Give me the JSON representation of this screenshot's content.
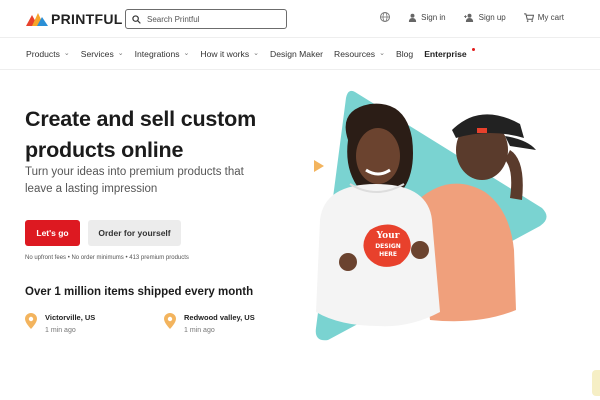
{
  "header": {
    "brand": "PRINTFUL",
    "search": {
      "placeholder": "Search Printful",
      "value": ""
    },
    "actions": [
      {
        "label": "Sign in",
        "icon": "user-icon"
      },
      {
        "label": "Sign up",
        "icon": "user-plus-icon"
      },
      {
        "label": "My cart",
        "icon": "cart-icon"
      }
    ]
  },
  "nav": {
    "items": [
      {
        "label": "Products",
        "dropdown": true
      },
      {
        "label": "Services",
        "dropdown": true
      },
      {
        "label": "Integrations",
        "dropdown": true
      },
      {
        "label": "How it works",
        "dropdown": true
      },
      {
        "label": "Design Maker",
        "dropdown": false
      },
      {
        "label": "Resources",
        "dropdown": true
      },
      {
        "label": "Blog",
        "dropdown": false
      },
      {
        "label": "Enterprise",
        "dropdown": false
      }
    ]
  },
  "hero": {
    "title_line1": "Create and sell custom",
    "title_line2": "products online",
    "subtitle": "Turn your ideas into premium products that leave a lasting impression",
    "primary_cta": "Let's go",
    "secondary_cta": "Order for yourself",
    "fineprint": "No upfront fees • No order minimums • 413 premium products",
    "hoodie_print": [
      "Your",
      "DESIGN",
      "HERE"
    ]
  },
  "shipped": {
    "headline": "Over 1 million items shipped every month",
    "locations": [
      {
        "name": "Victorville, US",
        "time": "1 min ago"
      },
      {
        "name": "Redwood valley, US",
        "time": "1 min ago"
      }
    ]
  },
  "colors": {
    "accent": "#dd1921",
    "teal": "#7ad3d1",
    "pin": "#f3b45e",
    "peach": "#f0b08a"
  }
}
